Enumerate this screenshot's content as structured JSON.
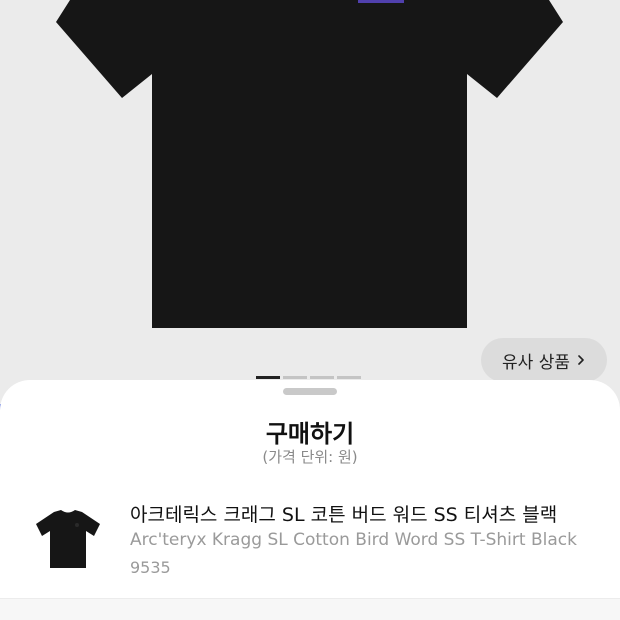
{
  "hero": {
    "image_icon": "tshirt-product-image",
    "shirt_color": "#161616",
    "logo_color": "#5a48c8",
    "background": "#ebebeb"
  },
  "similar_button": {
    "label": "유사 상품",
    "icon": "chevron-right-icon"
  },
  "pager": {
    "pages": 4,
    "active_index": 0
  },
  "sheet": {
    "title": "구매하기",
    "subtitle": "(가격 단위: 원)"
  },
  "product": {
    "name_ko": "아크테릭스 크래그 SL 코튼 버드 워드 SS 티셔츠 블랙",
    "name_en": "Arc'teryx Kragg SL Cotton Bird Word SS T-Shirt Black",
    "model_number": "9535",
    "thumb_icon": "tshirt-thumbnail-image"
  }
}
